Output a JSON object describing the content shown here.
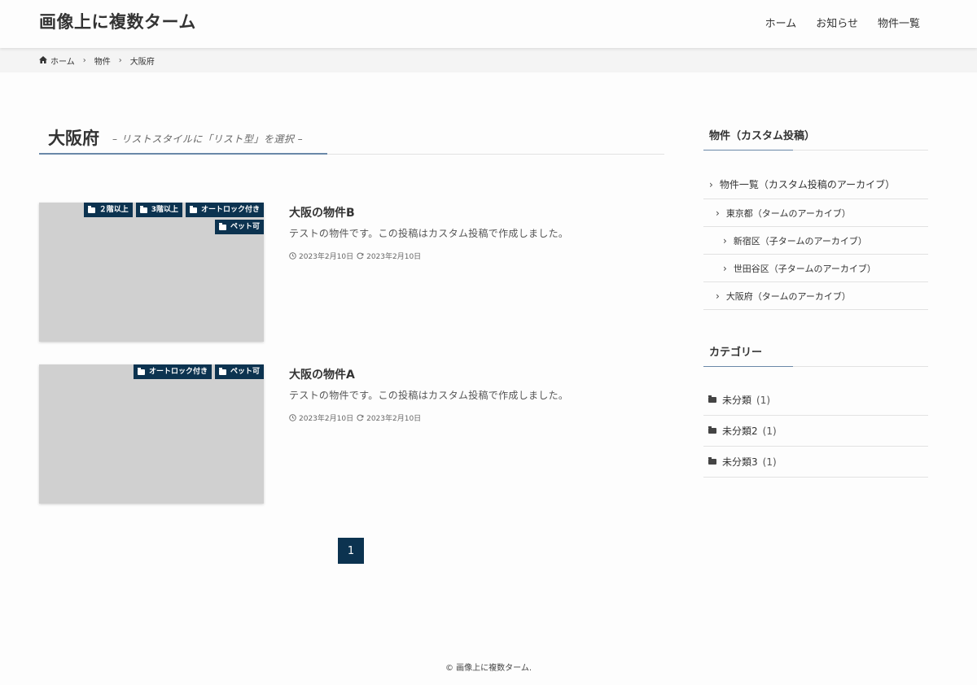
{
  "site": {
    "title": "画像上に複数ターム"
  },
  "nav": {
    "items": [
      {
        "label": "ホーム"
      },
      {
        "label": "お知らせ"
      },
      {
        "label": "物件一覧"
      }
    ]
  },
  "breadcrumb": {
    "items": [
      {
        "label": "ホーム"
      },
      {
        "label": "物件"
      },
      {
        "label": "大阪府"
      }
    ]
  },
  "page": {
    "title": "大阪府",
    "subtitle": "– リストスタイルに「リスト型」を選択 –"
  },
  "posts": [
    {
      "title": "大阪の物件B",
      "excerpt": "テストの物件です。この投稿はカスタム投稿で作成しました。",
      "published": "2023年2月10日",
      "updated": "2023年2月10日",
      "tags": [
        {
          "label": "２階以上"
        },
        {
          "label": "3階以上"
        },
        {
          "label": "オートロック付き"
        },
        {
          "label": "ペット可"
        }
      ]
    },
    {
      "title": "大阪の物件A",
      "excerpt": "テストの物件です。この投稿はカスタム投稿で作成しました。",
      "published": "2023年2月10日",
      "updated": "2023年2月10日",
      "tags": [
        {
          "label": "オートロック付き"
        },
        {
          "label": "ペット可"
        }
      ]
    }
  ],
  "pagination": {
    "current": "1"
  },
  "sidebar": {
    "custom_widget": {
      "title": "物件（カスタム投稿）",
      "items": [
        {
          "label": "物件一覧（カスタム投稿のアーカイブ）"
        },
        {
          "label": "東京都（タームのアーカイブ）"
        },
        {
          "label": "新宿区（子タームのアーカイブ）"
        },
        {
          "label": "世田谷区（子タームのアーカイブ）"
        },
        {
          "label": "大阪府（タームのアーカイブ）"
        }
      ]
    },
    "category_widget": {
      "title": "カテゴリー",
      "items": [
        {
          "label": "未分類",
          "count": "(1)"
        },
        {
          "label": "未分類2",
          "count": "(1)"
        },
        {
          "label": "未分類3",
          "count": "(1)"
        }
      ]
    }
  },
  "footer": {
    "copyright": "© 画像上に複数ターム."
  },
  "colors": {
    "tag_bg": "#0c3350",
    "accent_line": "#6a88a8",
    "thumb_bg": "#d0d0d0"
  }
}
